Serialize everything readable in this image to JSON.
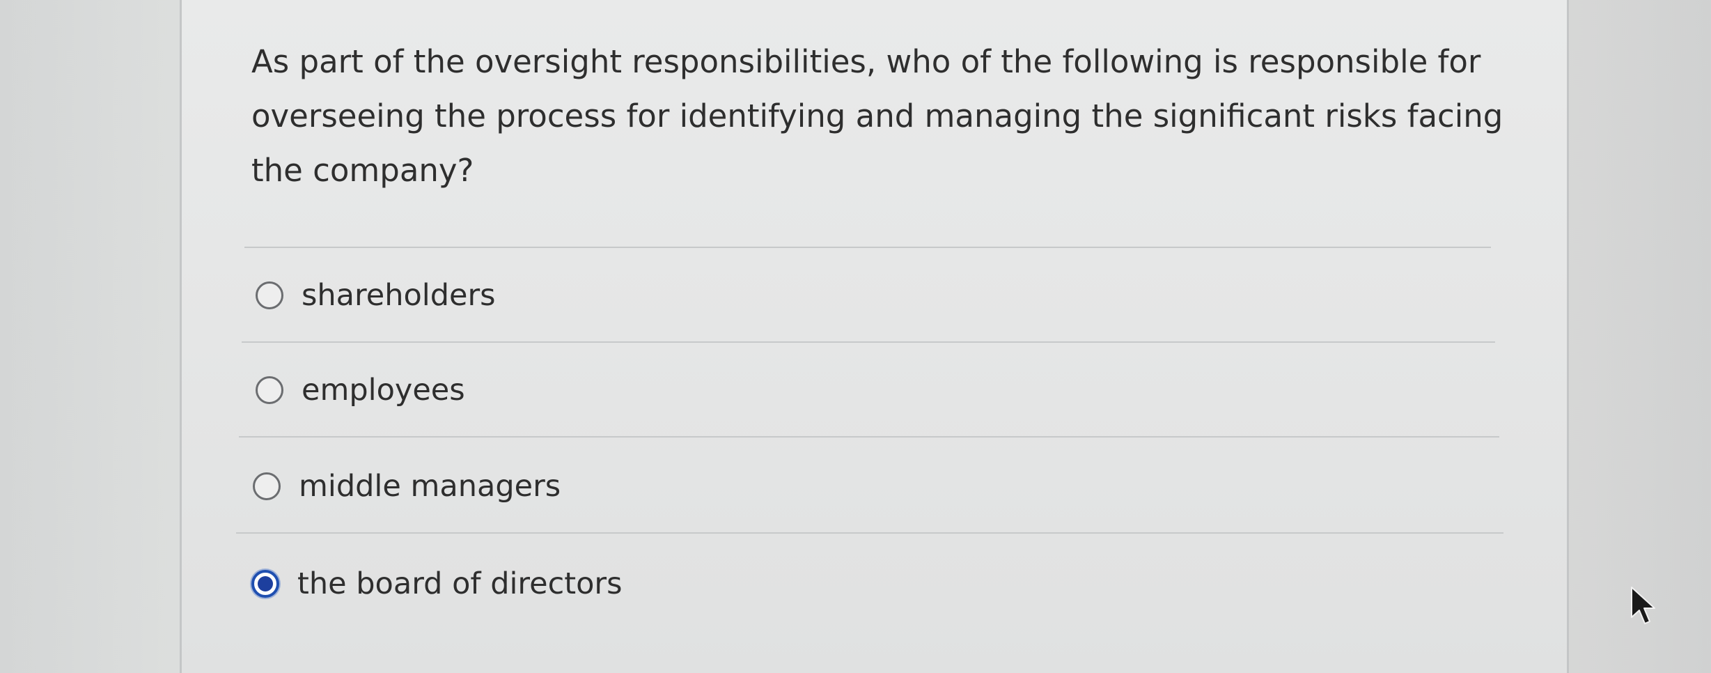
{
  "question": {
    "text": "As part of the oversight responsibilities, who of the following is responsible for overseeing the process for identifying and managing the significant risks facing the company?"
  },
  "options": [
    {
      "label": "shareholders",
      "selected": false
    },
    {
      "label": "employees",
      "selected": false
    },
    {
      "label": "middle managers",
      "selected": false
    },
    {
      "label": "the board of directors",
      "selected": true
    }
  ],
  "colors": {
    "selected_radio": "#1d3f9e",
    "unselected_radio_border": "#6b6d70",
    "text": "#2e2e2e"
  },
  "icons": {
    "cursor": "mouse-pointer-arrow"
  }
}
